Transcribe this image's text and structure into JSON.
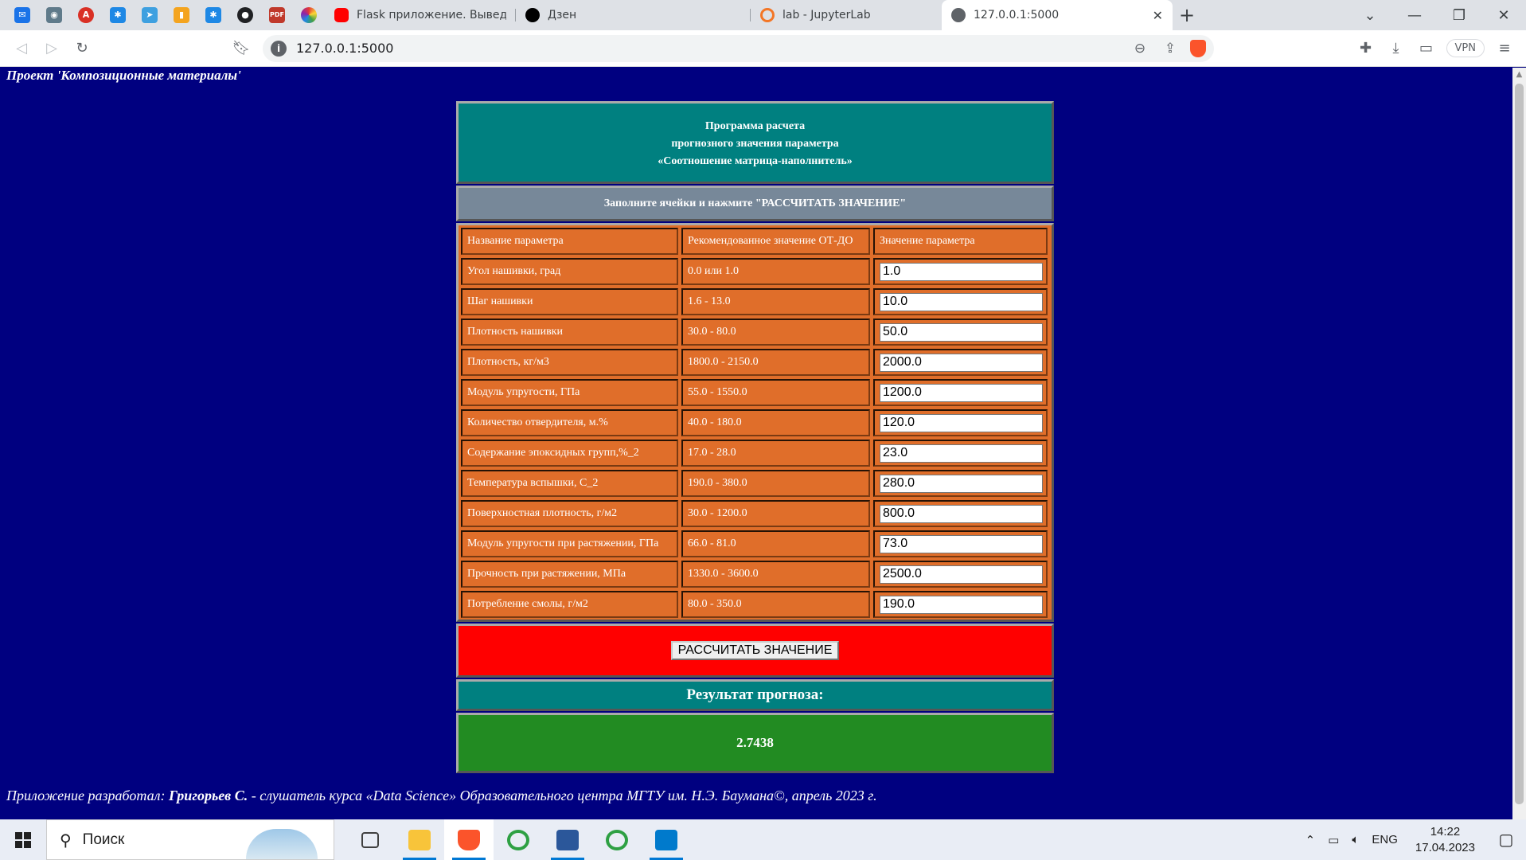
{
  "browser": {
    "pinned_tabs": [
      {
        "icon": "mail-icon",
        "color": "#1a73e8"
      },
      {
        "icon": "badge-icon",
        "color": "#5f7a8a"
      },
      {
        "icon": "acrobat-icon",
        "color": "#d93025"
      },
      {
        "icon": "star-app-icon",
        "color": "#1e88e5"
      },
      {
        "icon": "paper-plane-icon",
        "color": "#3ea0e0"
      },
      {
        "icon": "bar-chart-icon",
        "color": "#f4a41f"
      },
      {
        "icon": "star-app-icon",
        "color": "#1e88e5"
      },
      {
        "icon": "github-icon",
        "color": "#202124"
      },
      {
        "icon": "pdf24-icon",
        "color": "#c0392b"
      },
      {
        "icon": "color-wheel-icon",
        "color": "#8e44ad"
      }
    ],
    "tabs": [
      {
        "title": "Flask приложение. Выведение моде...",
        "icon": "youtube-icon",
        "color": "#ff0000"
      },
      {
        "title": "Дзен",
        "icon": "dzen-icon",
        "color": "#000000"
      },
      {
        "title": "lab - JupyterLab",
        "icon": "jupyter-icon",
        "color": "#f37626"
      },
      {
        "title": "127.0.0.1:5000",
        "icon": "globe-icon",
        "color": "#5f6368"
      }
    ],
    "address": "127.0.0.1:5000",
    "vpn_label": "VPN"
  },
  "page": {
    "project_title": "Проект 'Композиционные материалы'",
    "header_lines": [
      "Программа расчета",
      "прогнозного значения параметра",
      "«Соотношение матрица-наполнитель»"
    ],
    "instruction": "Заполните ячейки и нажмите \"РАССЧИТАТЬ ЗНАЧЕНИЕ\"",
    "columns": [
      "Название параметра",
      "Рекомендованное значение ОТ-ДО",
      "Значение параметра"
    ],
    "params": [
      {
        "name": "Угол нашивки, град",
        "range": "0.0 или 1.0",
        "value": "1.0"
      },
      {
        "name": "Шаг нашивки",
        "range": "1.6 - 13.0",
        "value": "10.0"
      },
      {
        "name": "Плотность нашивки",
        "range": "30.0 - 80.0",
        "value": "50.0"
      },
      {
        "name": "Плотность, кг/м3",
        "range": "1800.0 - 2150.0",
        "value": "2000.0"
      },
      {
        "name": "Модуль упругости, ГПа",
        "range": "55.0 - 1550.0",
        "value": "1200.0"
      },
      {
        "name": "Количество отвердителя, м.%",
        "range": "40.0 - 180.0",
        "value": "120.0"
      },
      {
        "name": "Содержание эпоксидных групп,%_2",
        "range": "17.0 - 28.0",
        "value": "23.0"
      },
      {
        "name": "Температура вспышки, С_2",
        "range": "190.0 - 380.0",
        "value": "280.0"
      },
      {
        "name": "Поверхностная плотность, г/м2",
        "range": "30.0 - 1200.0",
        "value": "800.0"
      },
      {
        "name": "Модуль упругости при растяжении, ГПа",
        "range": "66.0 - 81.0",
        "value": "73.0"
      },
      {
        "name": "Прочность при растяжении, МПа",
        "range": "1330.0 - 3600.0",
        "value": "2500.0"
      },
      {
        "name": "Потребление смолы, г/м2",
        "range": "80.0 - 350.0",
        "value": "190.0"
      }
    ],
    "submit_label": "РАССЧИТАТЬ ЗНАЧЕНИЕ",
    "result_label": "Результат прогноза:",
    "result_value": "2.7438",
    "footer_prefix": "Приложение разработал:",
    "footer_author": "Григорьев С.",
    "footer_suffix": "- слушатель курса «Data Science» Образовательного центра МГТУ им. Н.Э. Баумана©, апрель 2023 г.",
    "colors": {
      "background": "#000080",
      "header": "#008080",
      "instruction": "#778899",
      "params": "#e06e2a",
      "submit": "#ff0000",
      "result": "#228b22"
    }
  },
  "taskbar": {
    "search_placeholder": "Поиск",
    "apps": [
      {
        "icon": "task-view-icon"
      },
      {
        "icon": "file-explorer-icon",
        "color": "#f8c43a"
      },
      {
        "icon": "brave-browser-icon",
        "color": "#fb542b"
      },
      {
        "icon": "green-circle-app-icon",
        "color": "#2ea043"
      },
      {
        "icon": "word-icon",
        "color": "#2b579a"
      },
      {
        "icon": "green-circle-app-icon",
        "color": "#2ea043"
      },
      {
        "icon": "vscode-icon",
        "color": "#007acc"
      }
    ],
    "language": "ENG",
    "time": "14:22",
    "date": "17.04.2023"
  }
}
